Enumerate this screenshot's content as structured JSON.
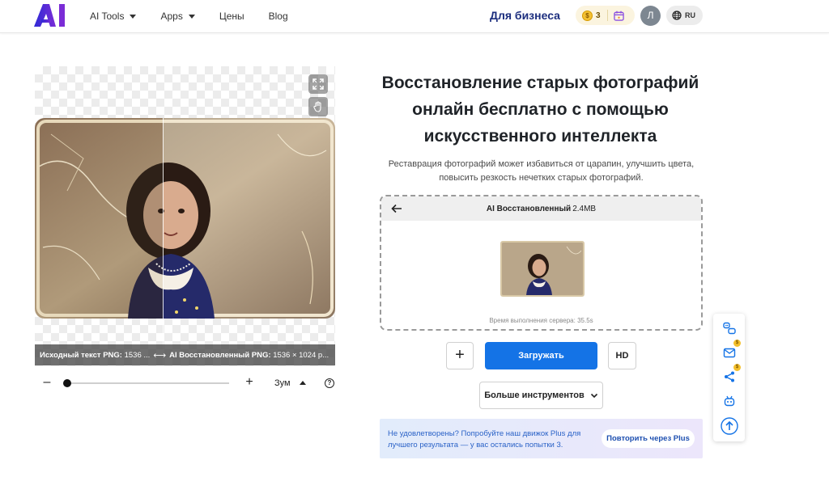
{
  "header": {
    "logo_text": "AI",
    "nav": [
      {
        "label": "AI Tools",
        "has_caret": true
      },
      {
        "label": "Apps",
        "has_caret": true
      },
      {
        "label": "Цены",
        "has_caret": false
      },
      {
        "label": "Blog",
        "has_caret": false
      }
    ],
    "business_link": "Для бизнеса",
    "credits": "3",
    "coin_glyph": "$",
    "avatar_letter": "Л",
    "language": "RU"
  },
  "viewer": {
    "original_label": "Исходный текст PNG:",
    "original_size": "1536 ...",
    "arrows": "⟷",
    "restored_label": "AI Восстановленный PNG:",
    "restored_size": "1536 × 1024 p..."
  },
  "zoom": {
    "minus": "–",
    "plus": "+",
    "label": "Зум",
    "help": "?",
    "level": 0
  },
  "main": {
    "title_lines": [
      "Восстановление старых фотографий",
      "онлайн бесплатно с помощью",
      "искусственного интеллекта"
    ],
    "subtitle_lines": [
      "Реставрация фотографий может избавиться от царапин, улучшить цвета,",
      "повысить резкость нечетких старых фотографий."
    ]
  },
  "result": {
    "name": "AI Восстановленный",
    "size": "2.4MB",
    "server_time": "Время выполнения сервера: 35.5s"
  },
  "actions": {
    "add": "+",
    "upload": "Загружать",
    "hd": "HD",
    "more": "Больше инструментов"
  },
  "plus_banner": {
    "text": "Не удовлетворены? Попробуйте наш движок Plus для лучшего результата — у вас остались попытки 3.",
    "button": "Повторить через Plus"
  },
  "side_toolbar": {
    "badge": "$"
  },
  "colors": {
    "brand": "#1473e6",
    "business": "#1c2e7e",
    "logo_gradient": [
      "#2a2fd6",
      "#8b2fd8"
    ]
  }
}
